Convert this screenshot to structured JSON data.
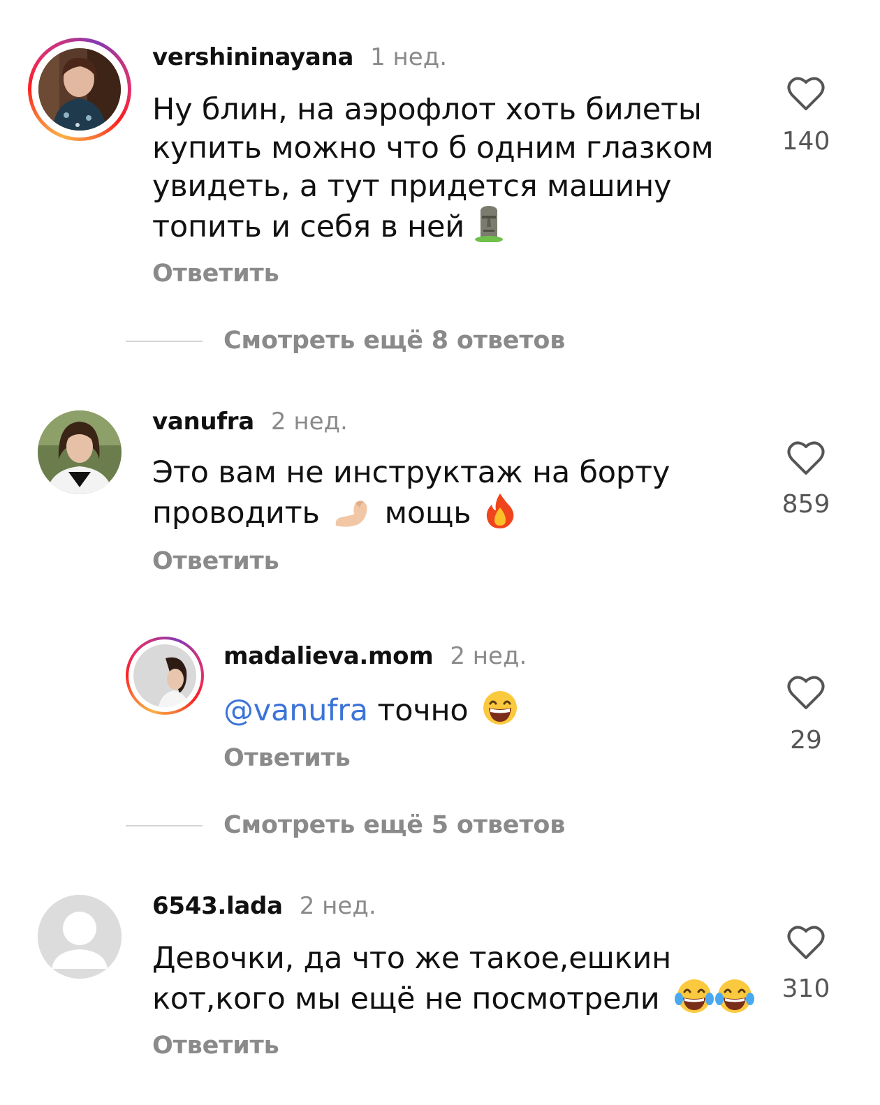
{
  "comments": [
    {
      "username": "vershininayana",
      "time": "1 нед.",
      "text_lines": [
        "Ну блин, на аэрофлот хоть билеты",
        "купить можно что б одним глазком",
        "увидеть, а тут придется машину",
        "топить и себя в ней"
      ],
      "emoji": "moai-emoji",
      "reply_label": "Ответить",
      "likes": "140",
      "story_ring": true
    },
    {
      "username": "vanufra",
      "time": "2 нед.",
      "text_parts": [
        "Это вам не инструктаж на борту",
        "проводить",
        "мощь"
      ],
      "reply_label": "Ответить",
      "likes": "859",
      "story_ring": false
    },
    {
      "username": "madalieva.mom",
      "time": "2 нед.",
      "mention": "@vanufra",
      "text": "точно",
      "reply_label": "Ответить",
      "likes": "29",
      "story_ring": true
    },
    {
      "username": "6543.lada",
      "time": "2 нед.",
      "text_lines": [
        "Девочки, да что же такое,ешкин",
        "кот,кого мы ещё не посмотрели"
      ],
      "reply_label": "Ответить",
      "likes": "310",
      "story_ring": false
    }
  ],
  "view_more": [
    {
      "label": "Смотреть ещё 8 ответов"
    },
    {
      "label": "Смотреть ещё 5 ответов"
    }
  ],
  "colors": {
    "mention": "#3b73d9",
    "secondary_text": "#8a8a8a",
    "divider": "#d5d5d5"
  }
}
